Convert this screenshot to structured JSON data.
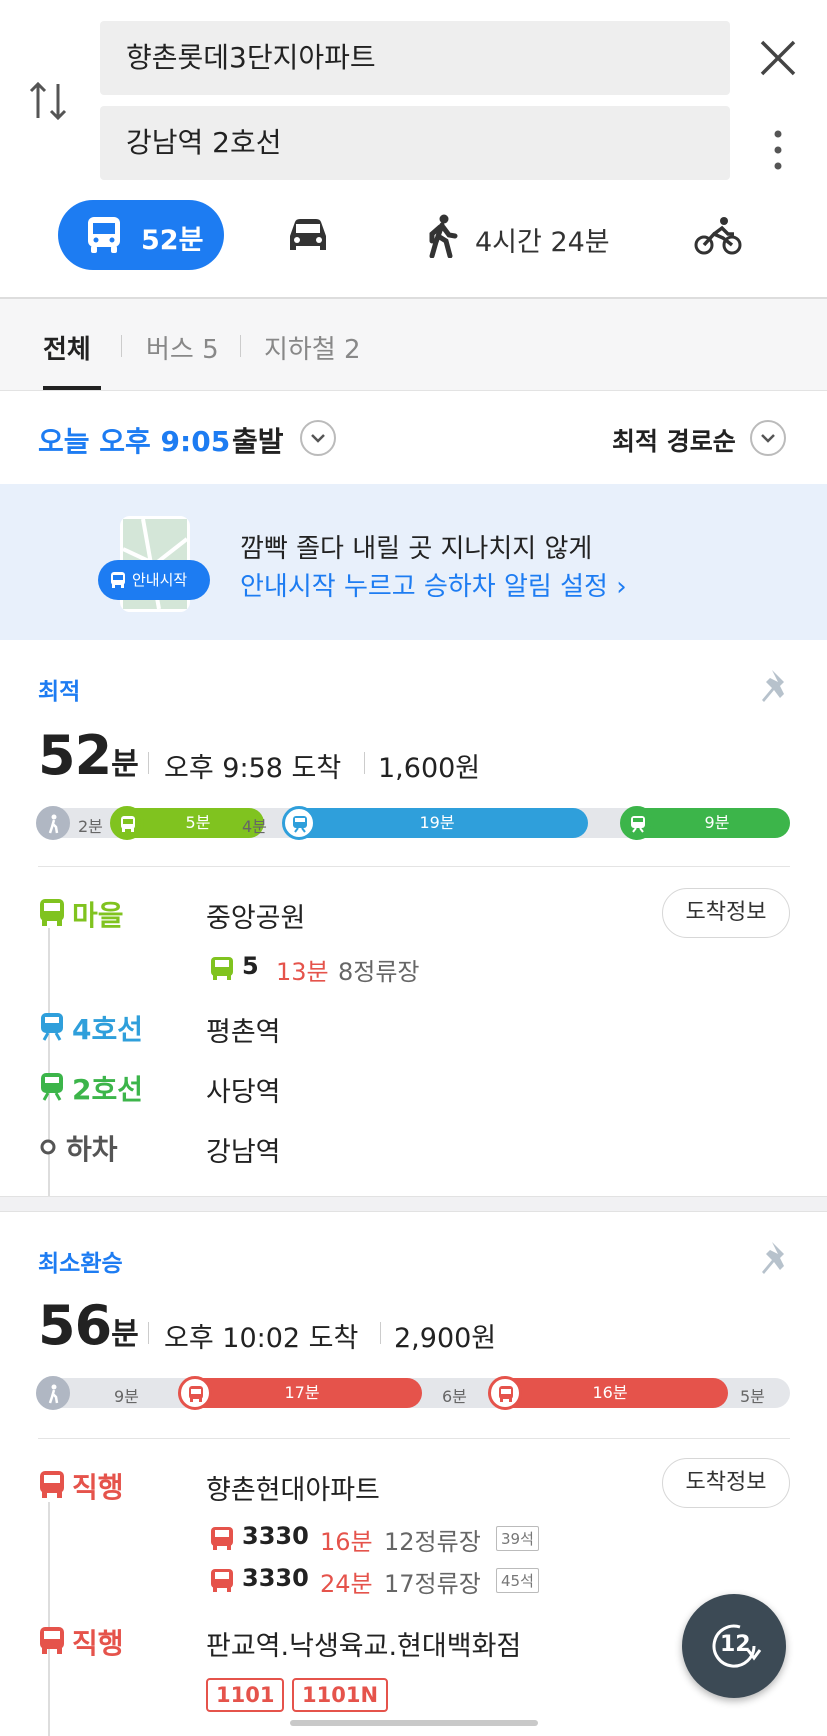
{
  "search": {
    "origin": "향촌롯데3단지아파트",
    "destination": "강남역 2호선"
  },
  "modes": {
    "transit_time": "52분",
    "walk_time": "4시간 24분"
  },
  "filter_tabs": {
    "all": "전체",
    "bus": "버스 5",
    "subway": "지하철 2"
  },
  "departure": {
    "time": "오늘 오후 9:05",
    "suffix": "출발",
    "sort": "최적 경로순"
  },
  "banner": {
    "button": "안내시작",
    "line1": "깜빡 졸다 내릴 곳 지나치지 않게",
    "line2": "안내시작 누르고 승하차 알림 설정 ›"
  },
  "routes": [
    {
      "type": "최적",
      "total_num": "52",
      "total_unit": "분",
      "arrival": "오후 9:58 도착",
      "fare": "1,600원",
      "timeline": {
        "walk1": "2분",
        "bus": "5분",
        "gap": "4분",
        "line4": "19분",
        "line2": "9분"
      },
      "legs": [
        {
          "kind": "마을",
          "stop": "중앙공원",
          "button": "도착정보",
          "bus_no": "5",
          "minutes": "13분",
          "stops": "8정류장"
        },
        {
          "kind": "4호선",
          "stop": "평촌역"
        },
        {
          "kind": "2호선",
          "stop": "사당역"
        },
        {
          "kind": "하차",
          "stop": "강남역"
        }
      ]
    },
    {
      "type": "최소환승",
      "total_num": "56",
      "total_unit": "분",
      "arrival": "오후 10:02 도착",
      "fare": "2,900원",
      "timeline": {
        "walk1": "9분",
        "bus1": "17분",
        "gap": "6분",
        "bus2": "16분",
        "end": "5분"
      },
      "legs": [
        {
          "kind": "직행",
          "stop": "향촌현대아파트",
          "button": "도착정보",
          "buses": [
            {
              "no": "3330",
              "minutes": "16분",
              "stops": "12정류장",
              "seats": "39석"
            },
            {
              "no": "3330",
              "minutes": "24분",
              "stops": "17정류장",
              "seats": "45석"
            }
          ]
        },
        {
          "kind": "직행",
          "stop": "판교역.낙생육교.현대백화점",
          "tags": [
            "1101",
            "1101N"
          ]
        }
      ]
    }
  ],
  "fab_label": "12",
  "colors": {
    "accent": "#1d7cf2",
    "village_bus": "#80c31f",
    "line4": "#2f9fdb",
    "line2": "#3cb54a",
    "express_bus": "#e5534b"
  }
}
